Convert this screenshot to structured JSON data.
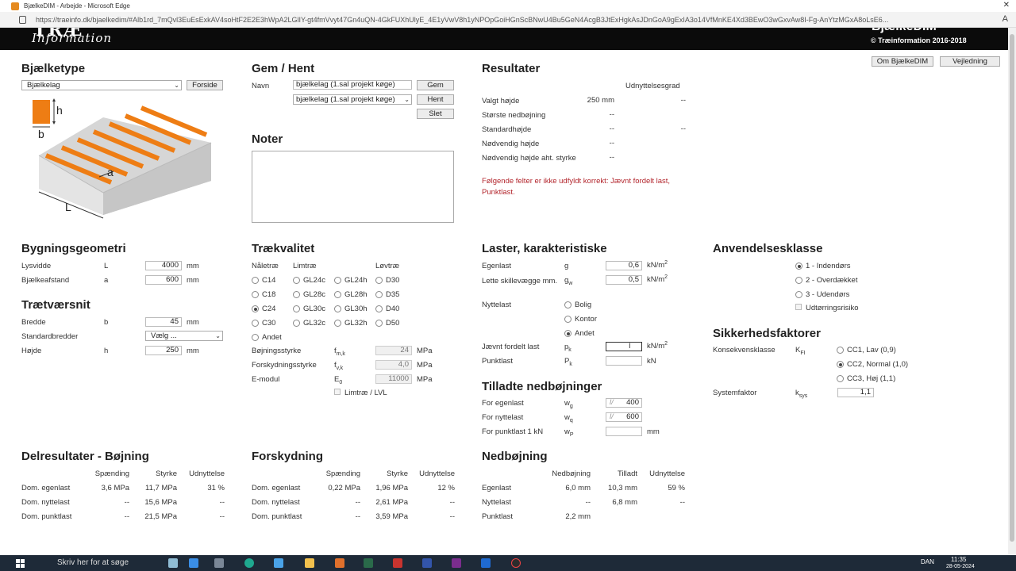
{
  "window": {
    "title": "BjælkeDIM - Arbejde - Microsoft Edge",
    "url": "https://traeinfo.dk/bjaelkedim/#Alb1rd_7mQvl3EuEsExkAV4soHtF2E2E3hWpA2LGlIY-gt4fmVvyt47Gn4uQN-4GkFUXhUlyE_4E1yVwV8h1yNPOpGoiHGnScBNwU4Bu5GeN4AcgB3JtExHgkAsJDnGoA9gExIA3o14VfMnKE4Xd3BEwO3wGxvAw8I-Fg-AnYtzMGxA8oLsE6..."
  },
  "header": {
    "logo_top": "TRÆ",
    "logo": "Information",
    "brand_top": "BjælkeDIM",
    "copyright": "© Træinformation 2016-2018"
  },
  "top_buttons": {
    "about": "Om BjælkeDIM",
    "guide": "Vejledning"
  },
  "bjaelketype": {
    "title": "Bjælketype",
    "select_value": "Bjælkelag",
    "front_button": "Forside",
    "diagram_labels": {
      "h": "h",
      "b": "b",
      "a": "a",
      "L": "L"
    }
  },
  "gem_hent": {
    "title": "Gem / Hent",
    "name_label": "Navn",
    "name_value": "bjælkelag (1.sal projekt køge)",
    "load_select": "bjælkelag (1.sal projekt køge)",
    "save": "Gem",
    "load": "Hent",
    "delete": "Slet"
  },
  "noter": {
    "title": "Noter"
  },
  "resultater": {
    "title": "Resultater",
    "col_header": "Udnyttelsesgrad",
    "rows": [
      {
        "label": "Valgt højde",
        "value": "250 mm",
        "util": "--"
      },
      {
        "label": "Største nedbøjning",
        "value": "--",
        "util": ""
      },
      {
        "label": "Standardhøjde",
        "value": "--",
        "util": "--"
      },
      {
        "label": "Nødvendig højde",
        "value": "--",
        "util": ""
      },
      {
        "label": "Nødvendig højde aht. styrke",
        "value": "--",
        "util": ""
      }
    ],
    "warning": "Følgende felter er ikke udfyldt korrekt: Jævnt fordelt last, Punktlast."
  },
  "bygningsgeometri": {
    "title": "Bygningsgeometri",
    "rows": [
      {
        "label": "Lysvidde",
        "sym": "L",
        "value": "4000",
        "unit": "mm"
      },
      {
        "label": "Bjælkeafstand",
        "sym": "a",
        "value": "600",
        "unit": "mm"
      }
    ]
  },
  "traetvaersnit": {
    "title": "Trætværsnit",
    "bredde": {
      "label": "Bredde",
      "sym": "b",
      "value": "45",
      "unit": "mm"
    },
    "standard": {
      "label": "Standardbredder",
      "value": "Vælg ..."
    },
    "hoejde": {
      "label": "Højde",
      "sym": "h",
      "value": "250",
      "unit": "mm"
    }
  },
  "traekvalitet": {
    "title": "Trækvalitet",
    "col_headers": [
      "Nåletræ",
      "Limtræ",
      "Løvtræ"
    ],
    "grades": [
      [
        "C14",
        "GL24c",
        "GL24h",
        "D30"
      ],
      [
        "C18",
        "GL28c",
        "GL28h",
        "D35"
      ],
      [
        "C24",
        "GL30c",
        "GL30h",
        "D40"
      ],
      [
        "C30",
        "GL32c",
        "GL32h",
        "D50"
      ]
    ],
    "selected": "C24",
    "other": "Andet",
    "props": [
      {
        "label": "Bøjningsstyrke",
        "sym": "f",
        "sub": "m,k",
        "value": "24",
        "unit": "MPa"
      },
      {
        "label": "Forskydningsstyrke",
        "sym": "f",
        "sub": "v,k",
        "value": "4,0",
        "unit": "MPa"
      },
      {
        "label": "E-modul",
        "sym": "E",
        "sub": "0",
        "value": "11000",
        "unit": "MPa"
      }
    ],
    "lvl_label": "Limtræ / LVL"
  },
  "laster": {
    "title": "Laster, karakteristiske",
    "egenlast": {
      "label": "Egenlast",
      "sym": "g",
      "value": "0,6",
      "unit": "kN/m",
      "sup": "2"
    },
    "lette": {
      "label": "Lette skillevægge mm.",
      "sym": "g",
      "sub": "w",
      "value": "0,5",
      "unit": "kN/m",
      "sup": "2"
    },
    "nyttelast": {
      "label": "Nyttelast",
      "options": [
        "Bolig",
        "Kontor",
        "Andet"
      ],
      "selected": "Andet"
    },
    "jaevnt": {
      "label": "Jævnt fordelt last",
      "sym": "p",
      "sub": "k",
      "value": "",
      "unit": "kN/m",
      "sup": "2"
    },
    "punkt": {
      "label": "Punktlast",
      "sym": "P",
      "sub": "k",
      "value": "",
      "unit": "kN"
    }
  },
  "anvendelsesklasse": {
    "title": "Anvendelsesklasse",
    "options": [
      "1 - Indendørs",
      "2 - Overdækket",
      "3 - Udendørs"
    ],
    "selected": "1 - Indendørs",
    "drying": "Udtørringsrisiko"
  },
  "sikkerhed": {
    "title": "Sikkerhedsfaktorer",
    "konsekvens_label": "Konsekvensklasse",
    "konsekvens_sym": "K",
    "konsekvens_sub": "FI",
    "options": [
      "CC1, Lav (0,9)",
      "CC2, Normal (1,0)",
      "CC3, Høj (1,1)"
    ],
    "selected": "CC2, Normal (1,0)",
    "system_label": "Systemfaktor",
    "system_sym": "k",
    "system_sub": "sys",
    "system_value": "1,1"
  },
  "tilladte": {
    "title": "Tilladte nedbøjninger",
    "rows": [
      {
        "label": "For egenlast",
        "sym": "w",
        "sub": "g",
        "prefix": "l/",
        "value": "400",
        "unit": ""
      },
      {
        "label": "For nyttelast",
        "sym": "w",
        "sub": "q",
        "prefix": "l/",
        "value": "600",
        "unit": ""
      },
      {
        "label": "For punktlast 1 kN",
        "sym": "w",
        "sub": "P",
        "prefix": "",
        "value": "",
        "unit": "mm"
      }
    ]
  },
  "delresultater": {
    "title": "Delresultater - Bøjning",
    "headers": [
      "Spænding",
      "Styrke",
      "Udnyttelse"
    ],
    "rows": [
      {
        "label": "Dom. egenlast",
        "c1": "3,6 MPa",
        "c2": "11,7 MPa",
        "c3": "31 %"
      },
      {
        "label": "Dom. nyttelast",
        "c1": "--",
        "c2": "15,6 MPa",
        "c3": "--"
      },
      {
        "label": "Dom. punktlast",
        "c1": "--",
        "c2": "21,5 MPa",
        "c3": "--"
      }
    ]
  },
  "forskydning": {
    "title": "Forskydning",
    "headers": [
      "Spænding",
      "Styrke",
      "Udnyttelse"
    ],
    "rows": [
      {
        "label": "Dom. egenlast",
        "c1": "0,22 MPa",
        "c2": "1,96 MPa",
        "c3": "12 %"
      },
      {
        "label": "Dom. nyttelast",
        "c1": "--",
        "c2": "2,61 MPa",
        "c3": "--"
      },
      {
        "label": "Dom. punktlast",
        "c1": "--",
        "c2": "3,59 MPa",
        "c3": "--"
      }
    ]
  },
  "nedbojning": {
    "title": "Nedbøjning",
    "headers": [
      "Nedbøjning",
      "Tilladt",
      "Udnyttelse"
    ],
    "rows": [
      {
        "label": "Egenlast",
        "c1": "6,0 mm",
        "c2": "10,3 mm",
        "c3": "59 %"
      },
      {
        "label": "Nyttelast",
        "c1": "--",
        "c2": "6,8 mm",
        "c3": "--"
      },
      {
        "label": "Punktlast",
        "c1": "2,2 mm",
        "c2": "",
        "c3": ""
      }
    ]
  },
  "taskbar": {
    "search": "Skriv her for at søge",
    "lang": "DAN",
    "time": "11:35",
    "date": "28-05-2024"
  }
}
